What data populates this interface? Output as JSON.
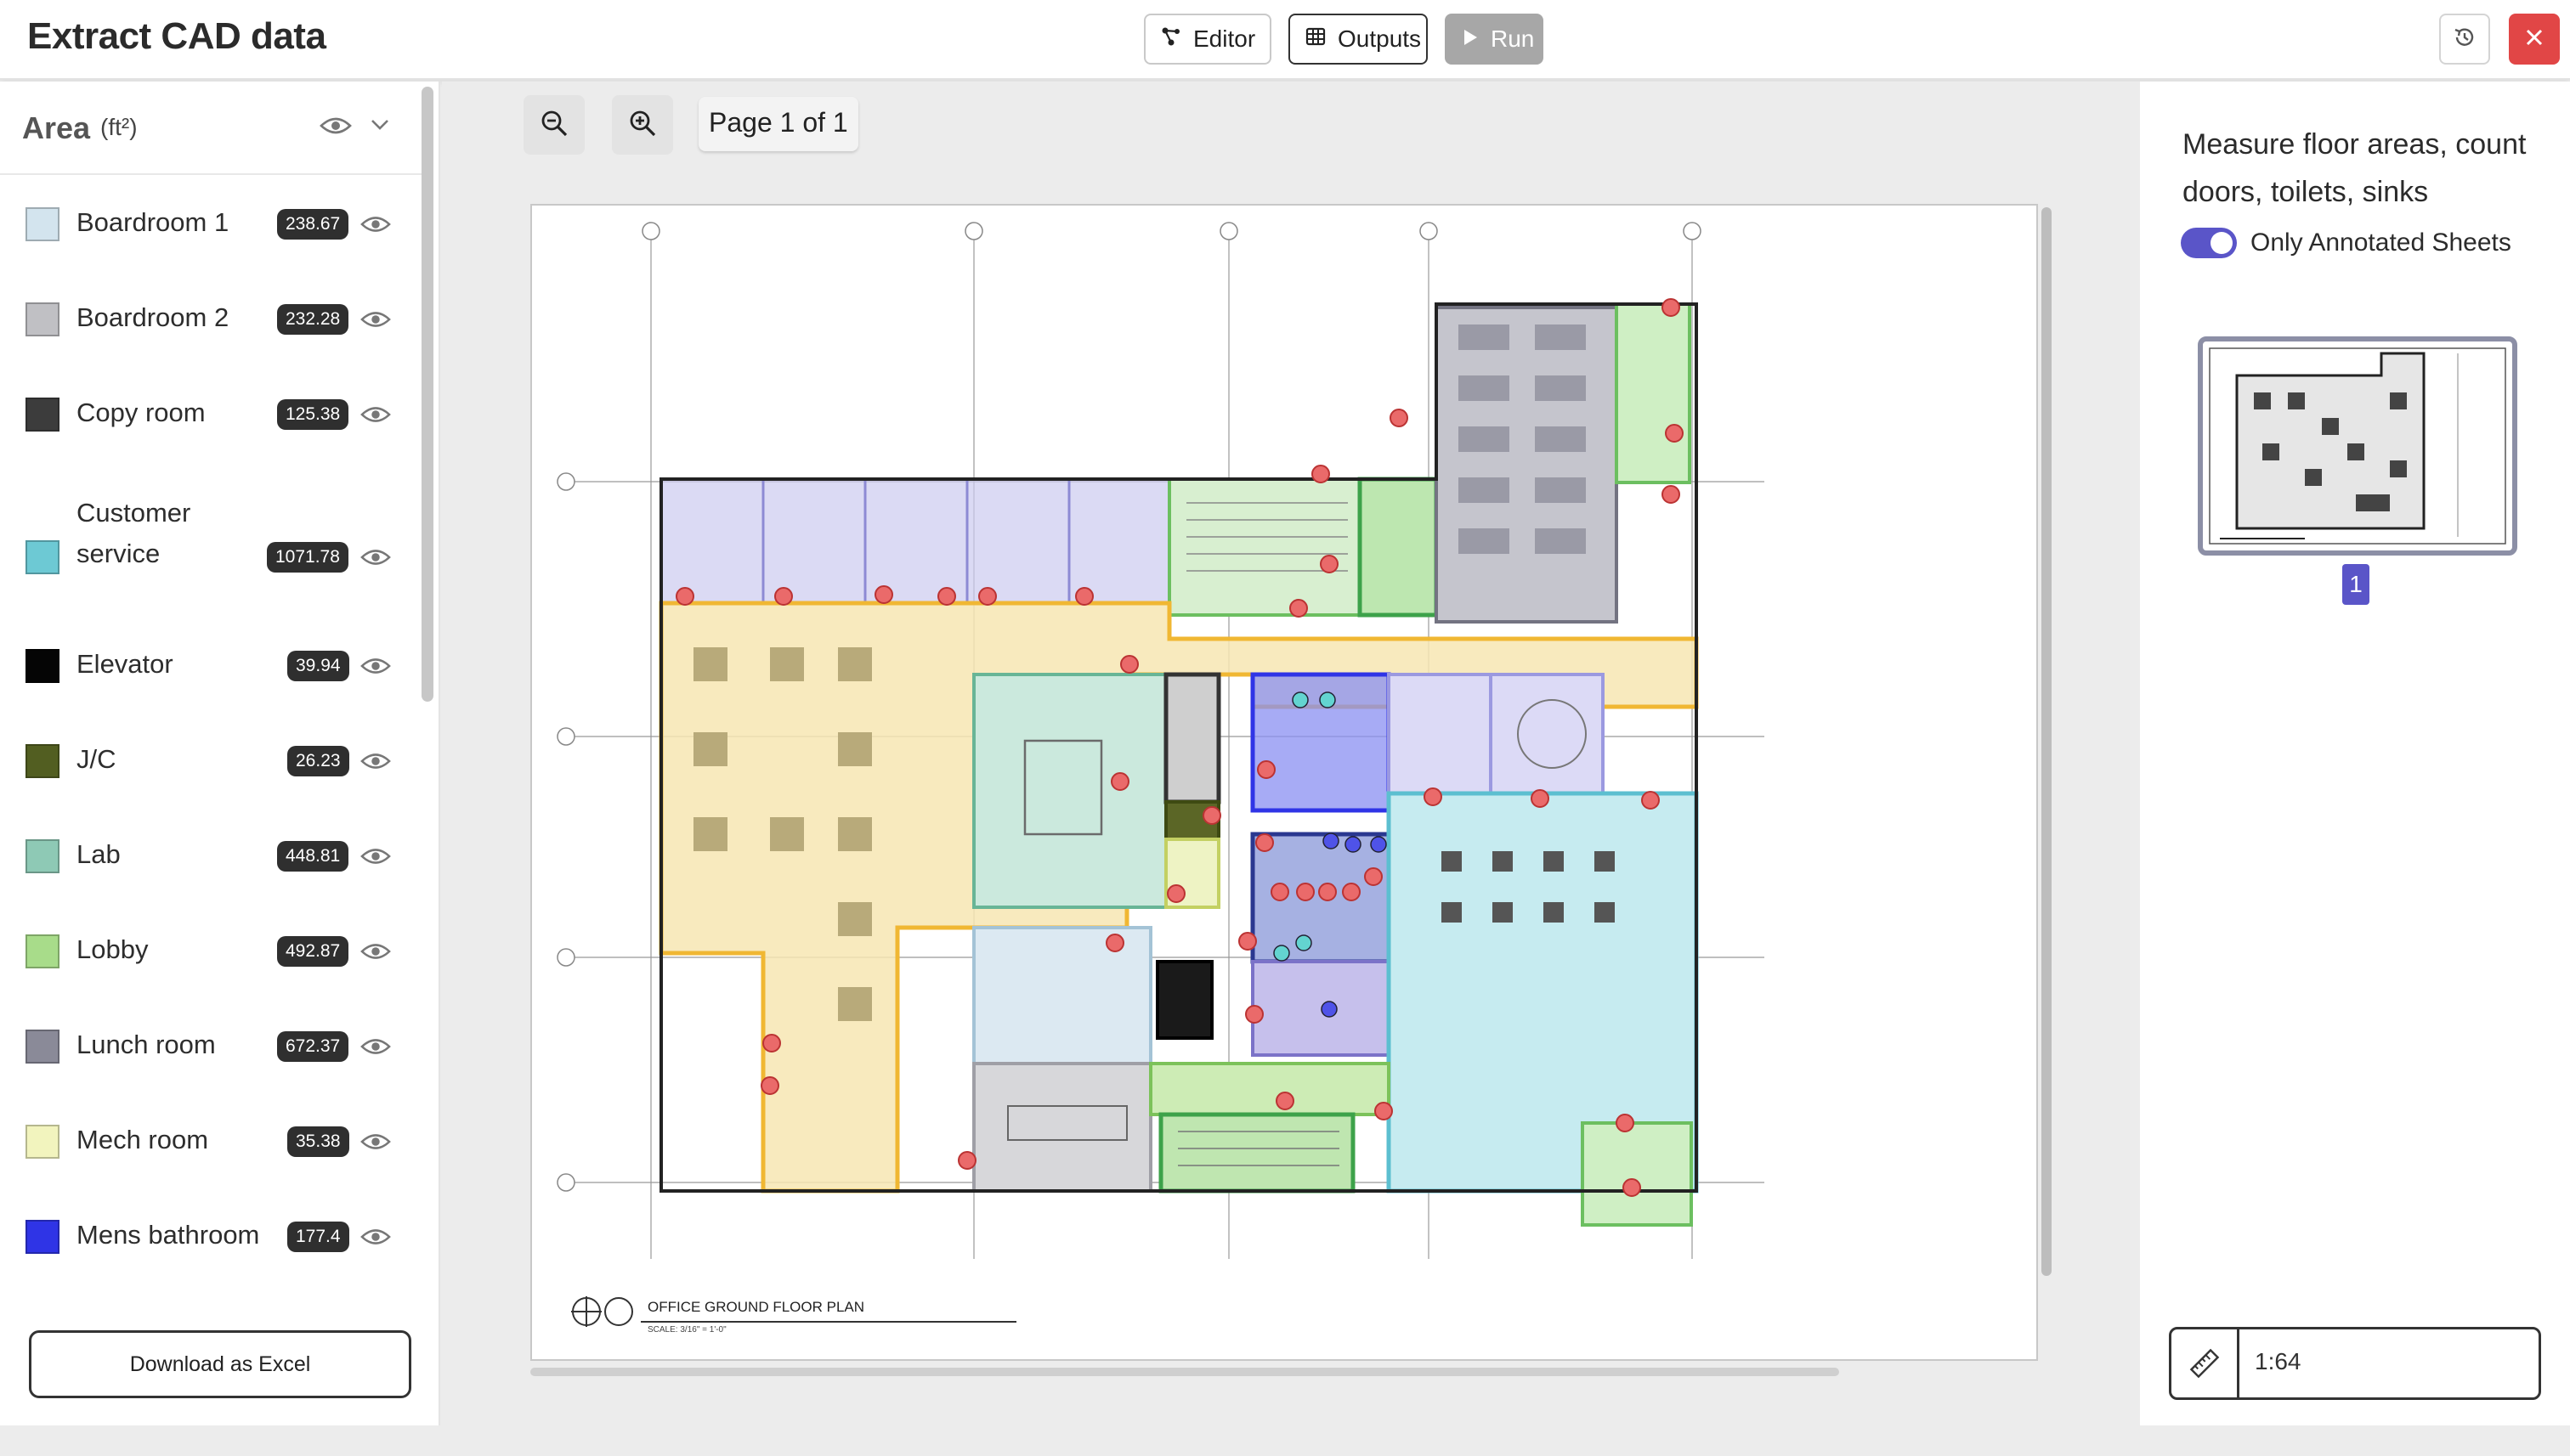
{
  "header": {
    "title": "Extract CAD data",
    "editor_label": "Editor",
    "outputs_label": "Outputs",
    "run_label": "Run"
  },
  "sidebar": {
    "title": "Area",
    "unit": "(ft²)",
    "items": [
      {
        "label": "Boardroom 1",
        "value": "238.67",
        "color": "#d3e4ee"
      },
      {
        "label": "Boardroom 2",
        "value": "232.28",
        "color": "#c0c0c4"
      },
      {
        "label": "Copy room",
        "value": "125.38",
        "color": "#3c3c3c"
      },
      {
        "label": "Customer service",
        "value": "1071.78",
        "color": "#6dc9d4"
      },
      {
        "label": "Elevator",
        "value": "39.94",
        "color": "#050505"
      },
      {
        "label": "J/C",
        "value": "26.23",
        "color": "#525e21"
      },
      {
        "label": "Lab",
        "value": "448.81",
        "color": "#8ec9b5"
      },
      {
        "label": "Lobby",
        "value": "492.87",
        "color": "#a8dc8a"
      },
      {
        "label": "Lunch room",
        "value": "672.37",
        "color": "#8a8a98"
      },
      {
        "label": "Mech room",
        "value": "35.38",
        "color": "#f2f4be"
      },
      {
        "label": "Mens bathroom",
        "value": "177.4",
        "color": "#2f34e6"
      }
    ],
    "download_label": "Download as Excel"
  },
  "viewer": {
    "page_label": "Page 1 of 1",
    "plan_title": "OFFICE GROUND FLOOR PLAN",
    "plan_subtitle": "SCALE: 3/16\" = 1'-0\""
  },
  "right_panel": {
    "description": "Measure floor areas, count doors, toilets, sinks",
    "toggle_label": "Only Annotated Sheets",
    "toggle_on": true,
    "page_badge": "1",
    "scale_value": "1:64"
  },
  "colors": {
    "accent": "#5a55c8",
    "danger": "#e14646",
    "marker": "#ea6a6a",
    "wall_highlight": "#f2c94c"
  },
  "icons": {
    "editor": "graph-nodes-icon",
    "outputs": "table-icon",
    "run": "play-icon",
    "history": "history-icon",
    "close": "close-icon",
    "visibility": "eye-icon",
    "collapse": "chevron-down-icon",
    "zoom_out": "zoom-out-icon",
    "zoom_in": "zoom-in-icon",
    "scale": "ruler-icon"
  }
}
